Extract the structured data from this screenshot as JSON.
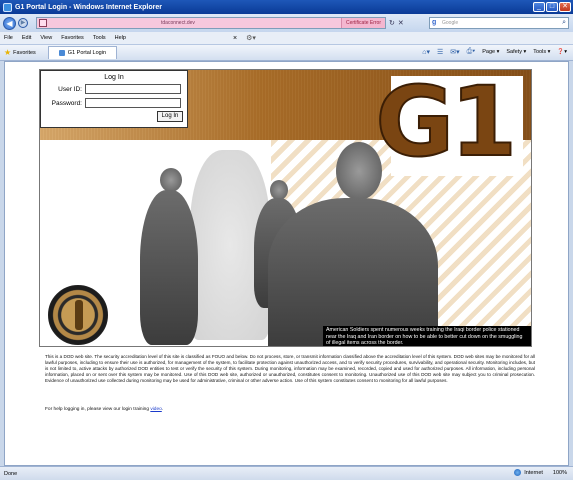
{
  "window": {
    "title": "G1 Portal Login - Windows Internet Explorer",
    "controls": [
      "_",
      "□",
      "✕"
    ]
  },
  "address_bar": {
    "url": "tdaconnect.dev",
    "certificate_label": "Certificate Error",
    "search_placeholder": "Google"
  },
  "menu": {
    "items": [
      "File",
      "Edit",
      "View",
      "Favorites",
      "Tools",
      "Help"
    ]
  },
  "favorites_bar": {
    "favorites_label": "Favorites",
    "tab_label": "G1 Portal Login",
    "commands": [
      "Page ▾",
      "Safety ▾",
      "Tools ▾",
      "❓▾"
    ]
  },
  "login": {
    "heading": "Log In",
    "userid_label": "User ID:",
    "password_label": "Password:",
    "userid_value": "",
    "password_value": "",
    "button_label": "Log In"
  },
  "banner": {
    "logo_text": "G1",
    "caption": "American Soldiers spent numerous weeks training the Iraqi border police stationed near the Iraq and Iran border on how to be able to better cut down on the smuggling of illegal items across the border."
  },
  "notice": {
    "text": "This is a DOD web site. The security accreditation level of this site is classified as FOUO and below. Do not process, store, or transmit information classified above the accreditation level of this system. DOD web sites may be monitored for all lawful purposes, including to ensure their use is authorized, for management of the system, to facilitate protection against unauthorized access, and to verify security procedures, survivability, and operational security. Monitoring includes, but is not limited to, active attacks by authorized DOD entities to test or verify the security of this system. During monitoring, information may be examined, recorded, copied and used for authorized purposes. All information, including personal information, placed on or sent over this system may be monitored. Use of this DOD web site, authorized or unauthorized, constitutes consent to monitoring. Unauthorized use of this DOD web site may subject you to criminal prosecution. Evidence of unauthorized use collected during monitoring may be used for administrative, criminal or other adverse action. Use of this system constitutes consent to monitoring for all lawful purposes.",
    "help_prefix": "For help logging in, please view our login training ",
    "help_link": "video",
    "help_suffix": "."
  },
  "status_bar": {
    "status": "Done",
    "zone": "Internet",
    "zoom": "100%"
  }
}
